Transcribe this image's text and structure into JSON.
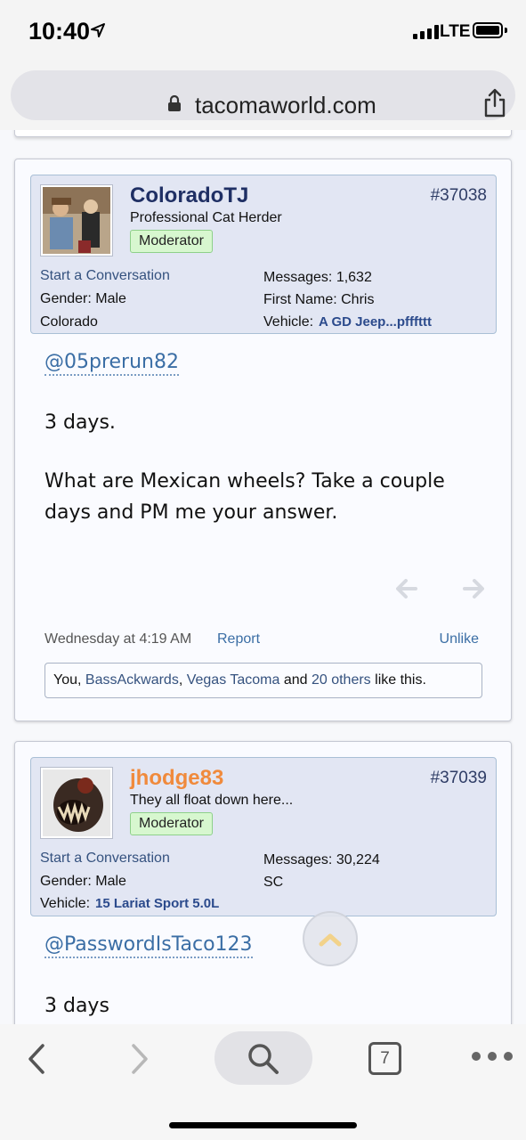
{
  "status_bar": {
    "time": "10:40",
    "network": "LTE",
    "battery_level": 0.95
  },
  "browser": {
    "url": "tacomaworld.com",
    "tab_count": "7"
  },
  "posts": [
    {
      "username": "ColoradoTJ",
      "user_title": "Professional Cat Herder",
      "badge": "Moderator",
      "post_number": "#37038",
      "start_conversation": "Start a Conversation",
      "gender": "Gender: Male",
      "location": "Colorado",
      "messages": "Messages: 1,632",
      "first_name": "First Name: Chris",
      "vehicle_label": "Vehicle:",
      "vehicle_value": "A GD Jeep...pfffttt",
      "mention": "@05prerun82",
      "body_line1": "3 days.",
      "body_line2": "What are Mexican wheels? Take a couple days and PM me your answer.",
      "date": "Wednesday at 4:19 AM",
      "report": "Report",
      "unlike": "Unlike",
      "likes": {
        "you": "You, ",
        "u1": "BassAckwards",
        "sep1": ", ",
        "u2": "Vegas Tacoma",
        "and": " and ",
        "others": "20 others",
        "tail": " like this."
      }
    },
    {
      "username": "jhodge83",
      "user_title": "They all float down here...",
      "badge": "Moderator",
      "post_number": "#37039",
      "start_conversation": "Start a Conversation",
      "gender": "Gender: Male",
      "messages": "Messages: 30,224",
      "location": "SC",
      "vehicle_label": "Vehicle:",
      "vehicle_value": "15 Lariat Sport 5.0L",
      "mention": "@PasswordIsTaco123",
      "body_line1": "3 days"
    }
  ]
}
